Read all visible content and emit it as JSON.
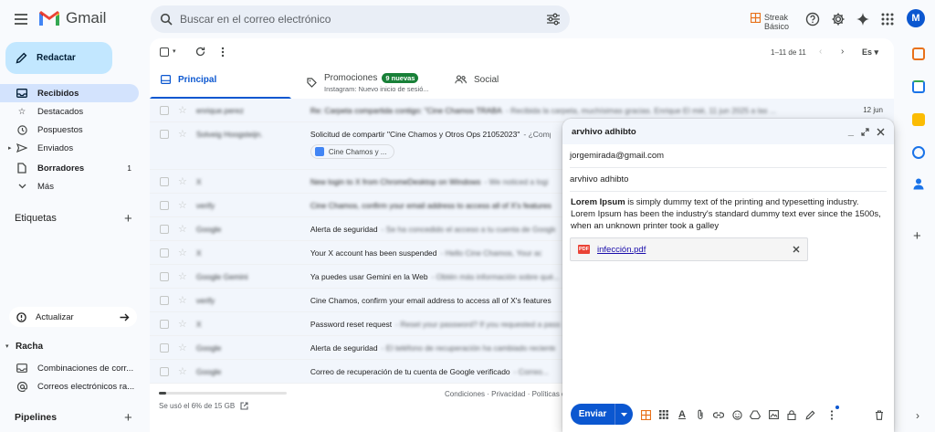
{
  "app": {
    "name": "Gmail"
  },
  "search": {
    "placeholder": "Buscar en el correo electrónico"
  },
  "streak": {
    "name": "Streak",
    "plan": "Básico"
  },
  "user": {
    "initial": "M"
  },
  "compose_button": {
    "label": "Redactar"
  },
  "nav": [
    {
      "label": "Recibidos",
      "icon": "inbox-icon",
      "active": true,
      "count": ""
    },
    {
      "label": "Destacados",
      "icon": "star-icon",
      "active": false,
      "count": ""
    },
    {
      "label": "Pospuestos",
      "icon": "clock-icon",
      "active": false,
      "count": ""
    },
    {
      "label": "Enviados",
      "icon": "send-icon",
      "active": false,
      "count": ""
    },
    {
      "label": "Borradores",
      "icon": "draft-icon",
      "active": false,
      "count": "1"
    },
    {
      "label": "Más",
      "icon": "chevron-down-icon",
      "active": false,
      "count": ""
    }
  ],
  "labels_section": {
    "title": "Etiquetas"
  },
  "update_button": {
    "label": "Actualizar"
  },
  "racha": {
    "title": "Racha",
    "items": [
      "Combinaciones de corr...",
      "Correos electrónicos ra..."
    ]
  },
  "pipelines": {
    "title": "Pipelines"
  },
  "toolbar": {
    "pagination": "1–11 de 11",
    "language": "Es"
  },
  "tabs": [
    {
      "label": "Principal",
      "sub": "",
      "badge": ""
    },
    {
      "label": "Promociones",
      "sub": "Instagram: Nuevo inicio de sesió...",
      "badge": "9 nuevas"
    },
    {
      "label": "Social",
      "sub": "",
      "badge": ""
    }
  ],
  "emails": [
    {
      "sender": "enrique.perez",
      "subject": "Re: Carpeta compartida contigo: \"Cine Chamos TRABAJANDO\"",
      "snippet": " - Recibida la carpeta, muchísimas gracias. Enrique El mié, 11 jun 2025 a las ...",
      "date": "12 jun",
      "blur_subject": true,
      "chip": ""
    },
    {
      "sender": "Solveig Hoogsteijn.",
      "subject": "Solicitud de compartir \"Cine Chamos y Otros Ops 21052023\"",
      "snippet": " - ¿Compartir...",
      "date": "",
      "blur_subject": false,
      "chip": "Cine Chamos y ..."
    },
    {
      "sender": "X",
      "subject": "New login to X from ChromeDesktop on Windows",
      "snippet": " - We noticed a login to your account...",
      "date": "",
      "blur_subject": true,
      "chip": ""
    },
    {
      "sender": "verify",
      "subject": "Cine Chamos, confirm your email address to access all of X's features",
      "snippet": "",
      "date": "",
      "blur_subject": true,
      "chip": ""
    },
    {
      "sender": "Google",
      "subject": "Alerta de seguridad",
      "snippet": " - Se ha concedido el acceso a tu cuenta de Google...",
      "date": "",
      "blur_subject": false,
      "chip": ""
    },
    {
      "sender": "X",
      "subject": "Your X account has been suspended",
      "snippet": " - Hello Cine Chamos, Your account...",
      "date": "",
      "blur_subject": false,
      "chip": ""
    },
    {
      "sender": "Google Gemini",
      "subject": "Ya puedes usar Gemini en la Web",
      "snippet": " - Obtén más información sobre qué...",
      "date": "",
      "blur_subject": false,
      "chip": ""
    },
    {
      "sender": "verify",
      "subject": "Cine Chamos, confirm your email address to access all of X's features",
      "snippet": "",
      "date": "",
      "blur_subject": false,
      "chip": ""
    },
    {
      "sender": "X",
      "subject": "Password reset request",
      "snippet": " - Reset your password? If you requested a password...",
      "date": "",
      "blur_subject": false,
      "chip": ""
    },
    {
      "sender": "Google",
      "subject": "Alerta de seguridad",
      "snippet": " - El teléfono de recuperación ha cambiado recientemente...",
      "date": "",
      "blur_subject": false,
      "chip": ""
    },
    {
      "sender": "Google",
      "subject": "Correo de recuperación de tu cuenta de Google verificado",
      "snippet": " - Correo...",
      "date": "",
      "blur_subject": false,
      "chip": ""
    }
  ],
  "storage": {
    "text": "Se usó el 6% de 15 GB",
    "fraction": 0.06
  },
  "footer": {
    "text": "Condiciones · Privacidad · Políticas de"
  },
  "compose": {
    "title": "arvhivo adhibto",
    "to": "jorgemirada@gmail.com",
    "subject": "arvhivo adhibto",
    "body_bold": "Lorem Ipsum",
    "body_rest": " is simply dummy text of the printing and typesetting industry. Lorem Ipsum has been the industry's standard dummy text ever since the 1500s, when an unknown printer took a galley",
    "attachment": "infección.pdf",
    "attachment_type": "PDF",
    "send_label": "Enviar"
  },
  "colors": {
    "accent": "#0b57d0",
    "compose_bg": "#c2e7ff",
    "active_nav": "#d3e3fd",
    "badge": "#188038"
  }
}
